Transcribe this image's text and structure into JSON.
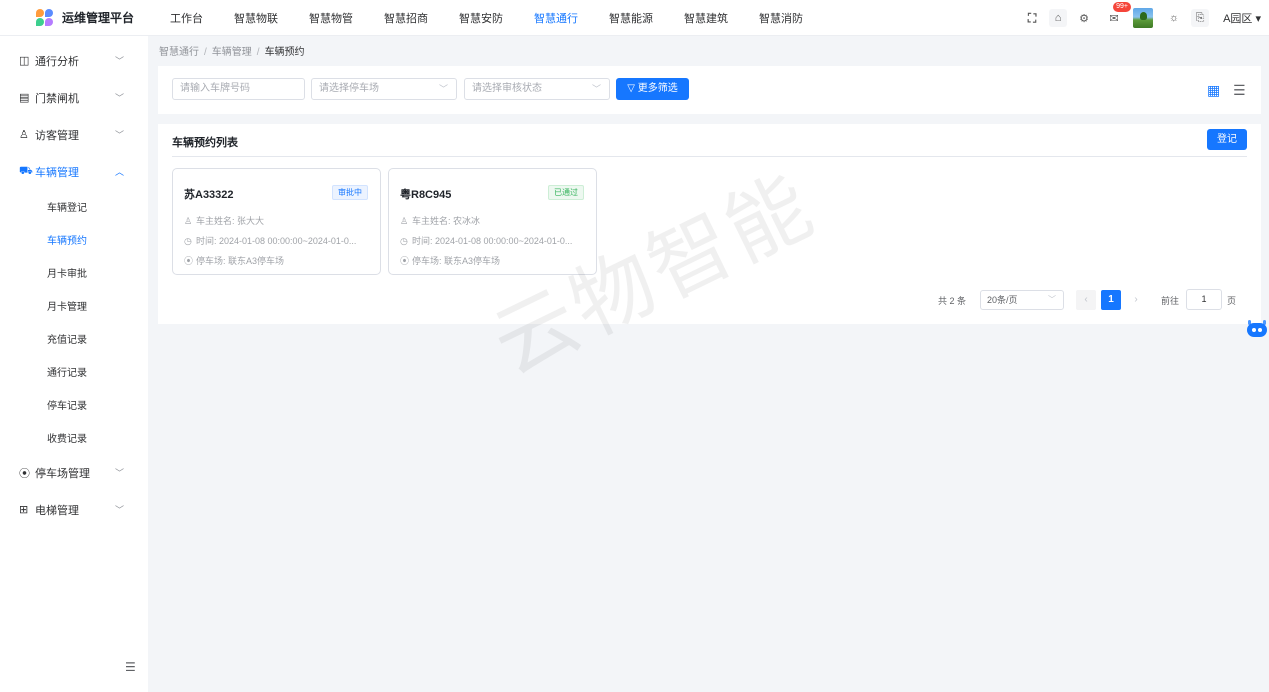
{
  "brand": {
    "title": "运维管理平台"
  },
  "nav": [
    {
      "label": "工作台"
    },
    {
      "label": "智慧物联"
    },
    {
      "label": "智慧物管"
    },
    {
      "label": "智慧招商"
    },
    {
      "label": "智慧安防"
    },
    {
      "label": "智慧通行",
      "active": true
    },
    {
      "label": "智慧能源"
    },
    {
      "label": "智慧建筑"
    },
    {
      "label": "智慧消防"
    }
  ],
  "header": {
    "notification_count": "99+",
    "area": "A园区"
  },
  "sidebar": {
    "groups": [
      {
        "label": "通行分析",
        "icon": "chart-icon"
      },
      {
        "label": "门禁闸机",
        "icon": "gate-icon"
      },
      {
        "label": "访客管理",
        "icon": "visitor-icon"
      },
      {
        "label": "车辆管理",
        "icon": "car-icon",
        "open": true
      },
      {
        "label": "停车场管理",
        "icon": "location-icon"
      },
      {
        "label": "电梯管理",
        "icon": "elevator-icon"
      }
    ],
    "vehicle_items": [
      {
        "label": "车辆登记"
      },
      {
        "label": "车辆预约",
        "active": true
      },
      {
        "label": "月卡审批"
      },
      {
        "label": "月卡管理"
      },
      {
        "label": "充值记录"
      },
      {
        "label": "通行记录"
      },
      {
        "label": "停车记录"
      },
      {
        "label": "收费记录"
      }
    ]
  },
  "breadcrumb": {
    "level1": "智慧通行",
    "level2": "车辆管理",
    "current": "车辆预约"
  },
  "filters": {
    "plate_placeholder": "请输入车牌号码",
    "parking_placeholder": "请选择停车场",
    "status_placeholder": "请选择审核状态",
    "more_label": "更多筛选"
  },
  "list": {
    "title": "车辆预约列表",
    "register_label": "登记",
    "cards": [
      {
        "plate": "苏A33322",
        "status": "审批中",
        "owner": "车主姓名: 张大大",
        "time": "时间: 2024-01-08 00:00:00~2024-01-0...",
        "parking": "停车场: 联东A3停车场"
      },
      {
        "plate": "粤R8C945",
        "status": "已通过",
        "owner": "车主姓名: 农冰冰",
        "time": "时间: 2024-01-08 00:00:00~2024-01-0...",
        "parking": "停车场: 联东A3停车场"
      }
    ]
  },
  "pagination": {
    "total": "共 2 条",
    "page_size": "20条/页",
    "current_page": "1",
    "goto_label": "前往",
    "goto_value": "1",
    "goto_unit": "页"
  },
  "watermark": "云物智能",
  "colors": {
    "accent": "#1677ff",
    "pending": "#1677ff",
    "passed": "#35b35c",
    "badge": "#f5453a"
  }
}
